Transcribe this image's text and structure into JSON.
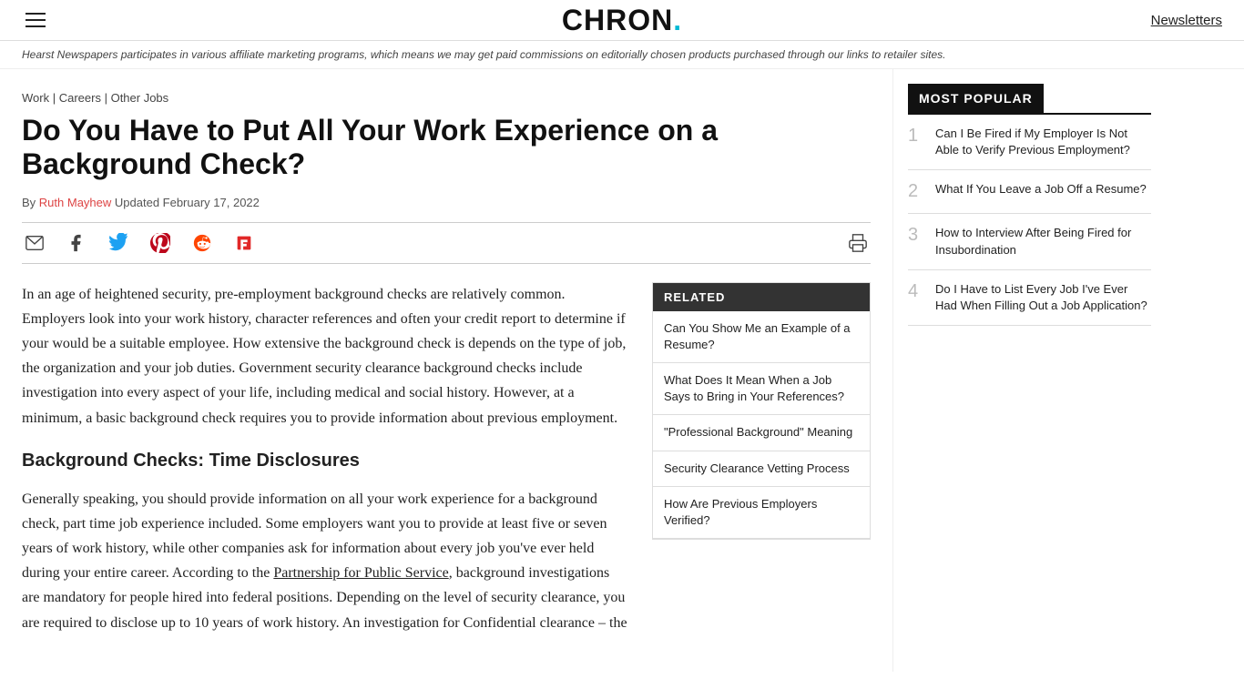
{
  "header": {
    "logo": "CHRON",
    "logo_dot": ".",
    "newsletters_label": "Newsletters"
  },
  "affiliate_bar": {
    "text": "Hearst Newspapers participates in various affiliate marketing programs, which means we may get paid commissions on editorially chosen products purchased through our links to retailer sites."
  },
  "breadcrumbs": {
    "work": "Work",
    "separator1": " | ",
    "careers": "Careers",
    "separator2": " | ",
    "other_jobs": "Other Jobs"
  },
  "article": {
    "title": "Do You Have to Put All Your Work Experience on a Background Check?",
    "author_label": "By ",
    "author_name": "Ruth Mayhew",
    "updated_label": " Updated February 17, 2022",
    "body_p1": "In an age of heightened security, pre-employment background checks are relatively common. Employers look into your work history, character references and often your credit report to determine if your would be a suitable employee. How extensive the background check is depends on the type of job, the organization and your job duties. Government security clearance background checks include investigation into every aspect of your life, including medical and social history. However, at a minimum, a basic background check requires you to provide information about previous employment.",
    "section_heading": "Background Checks: Time Disclosures",
    "body_p2": "Generally speaking, you should provide information on all your work experience for a background check, part time job experience included. Some employers want you to provide at least five or seven years of work history, while other companies ask for information about every job you've ever held during your entire career. According to the ",
    "body_link": "Partnership for Public Service",
    "body_p2b": ", background investigations are mandatory for people hired into federal positions. Depending on the level of security clearance, you are required to disclose up to 10 years of work history. An investigation for Confidential clearance – the"
  },
  "related": {
    "header": "RELATED",
    "items": [
      {
        "text": "Can You Show Me an Example of a Resume?"
      },
      {
        "text": "What Does It Mean When a Job Says to Bring in Your References?"
      },
      {
        "text": "\"Professional Background\" Meaning"
      },
      {
        "text": "Security Clearance Vetting Process"
      },
      {
        "text": "How Are Previous Employers Verified?"
      }
    ]
  },
  "most_popular": {
    "header": "MOST POPULAR",
    "items": [
      {
        "num": "1",
        "text": "Can I Be Fired if My Employer Is Not Able to Verify Previous Employment?"
      },
      {
        "num": "2",
        "text": "What If You Leave a Job Off a Resume?"
      },
      {
        "num": "3",
        "text": "How to Interview After Being Fired for Insubordination"
      },
      {
        "num": "4",
        "text": "Do I Have to List Every Job I've Ever Had When Filling Out a Job Application?"
      }
    ]
  },
  "share": {
    "email_title": "Share via Email",
    "facebook_title": "Share on Facebook",
    "twitter_title": "Share on Twitter",
    "pinterest_title": "Share on Pinterest",
    "reddit_title": "Share on Reddit",
    "flipboard_title": "Share on Flipboard",
    "print_title": "Print"
  }
}
